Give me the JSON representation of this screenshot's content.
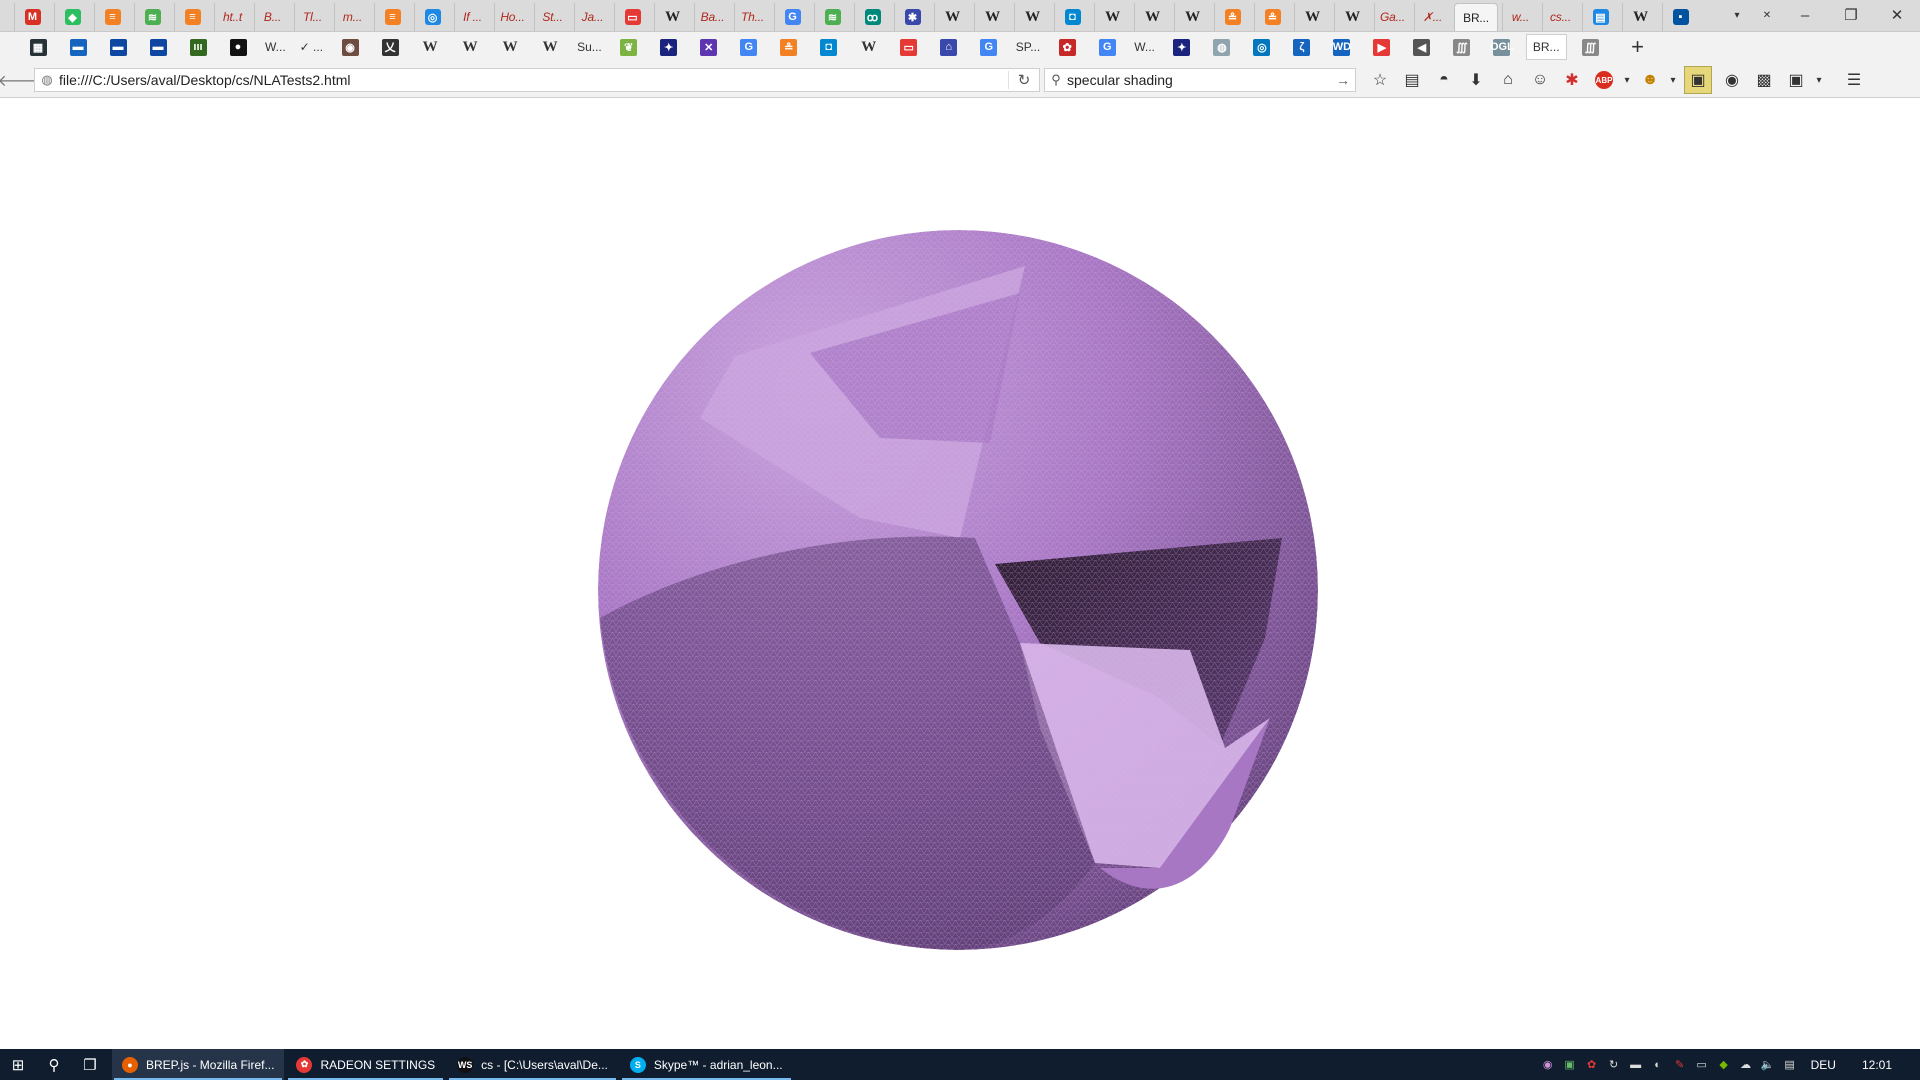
{
  "browser": {
    "tabs": [
      {
        "favicon": "gmail-icon",
        "color": "#d93025",
        "glyph": "M",
        "text": ""
      },
      {
        "favicon": "evernote-icon",
        "color": "#2dbe60",
        "glyph": "◆",
        "text": ""
      },
      {
        "favicon": "stack-icon",
        "color": "#f48024",
        "glyph": "≡",
        "text": ""
      },
      {
        "favicon": "wolfram-icon",
        "color": "#4caf50",
        "glyph": "≋",
        "text": ""
      },
      {
        "favicon": "stack-icon",
        "color": "#f48024",
        "glyph": "≡",
        "text": ""
      },
      {
        "favicon": "",
        "color": "",
        "glyph": "",
        "text": "ht..t"
      },
      {
        "favicon": "",
        "color": "",
        "glyph": "",
        "text": "B..."
      },
      {
        "favicon": "",
        "color": "",
        "glyph": "",
        "text": "Tl..."
      },
      {
        "favicon": "",
        "color": "",
        "glyph": "",
        "text": "m..."
      },
      {
        "favicon": "stack-icon",
        "color": "#f48024",
        "glyph": "≡",
        "text": ""
      },
      {
        "favicon": "discord-icon",
        "color": "#1e88e5",
        "glyph": "◎",
        "text": ""
      },
      {
        "favicon": "",
        "color": "",
        "glyph": "",
        "text": "If ..."
      },
      {
        "favicon": "",
        "color": "",
        "glyph": "",
        "text": "Ho..."
      },
      {
        "favicon": "",
        "color": "",
        "glyph": "",
        "text": "St..."
      },
      {
        "favicon": "",
        "color": "",
        "glyph": "",
        "text": "Ja..."
      },
      {
        "favicon": "oracle-icon",
        "color": "#e53935",
        "glyph": "▭",
        "text": ""
      },
      {
        "favicon": "",
        "color": "",
        "glyph": "",
        "text": "W",
        "wiki": true
      },
      {
        "favicon": "",
        "color": "",
        "glyph": "",
        "text": "Ba..."
      },
      {
        "favicon": "",
        "color": "",
        "glyph": "",
        "text": "Th..."
      },
      {
        "favicon": "google-icon",
        "color": "#4285f4",
        "glyph": "G",
        "text": ""
      },
      {
        "favicon": "wolfram-icon",
        "color": "#4caf50",
        "glyph": "≋",
        "text": ""
      },
      {
        "favicon": "script-icon",
        "color": "#00897b",
        "glyph": "ꝏ",
        "text": ""
      },
      {
        "favicon": "shield-icon",
        "color": "#3949ab",
        "glyph": "✱",
        "text": ""
      },
      {
        "favicon": "",
        "color": "",
        "glyph": "",
        "text": "W",
        "wiki": true
      },
      {
        "favicon": "",
        "color": "",
        "glyph": "",
        "text": "W",
        "wiki": true
      },
      {
        "favicon": "",
        "color": "",
        "glyph": "",
        "text": "W",
        "wiki": true
      },
      {
        "favicon": "chat-icon",
        "color": "#0288d1",
        "glyph": "◘",
        "text": ""
      },
      {
        "favicon": "",
        "color": "",
        "glyph": "",
        "text": "W",
        "wiki": true
      },
      {
        "favicon": "",
        "color": "",
        "glyph": "",
        "text": "W",
        "wiki": true
      },
      {
        "favicon": "",
        "color": "",
        "glyph": "",
        "text": "W",
        "wiki": true
      },
      {
        "favicon": "stack-icon",
        "color": "#f48024",
        "glyph": "≗",
        "text": ""
      },
      {
        "favicon": "stack-icon",
        "color": "#f48024",
        "glyph": "≗",
        "text": ""
      },
      {
        "favicon": "",
        "color": "",
        "glyph": "",
        "text": "W",
        "wiki": true
      },
      {
        "favicon": "",
        "color": "",
        "glyph": "",
        "text": "W",
        "wiki": true
      },
      {
        "favicon": "",
        "color": "",
        "glyph": "",
        "text": "Ga..."
      },
      {
        "favicon": "",
        "color": "",
        "glyph": "",
        "text": "✗..."
      },
      {
        "favicon": "",
        "color": "",
        "glyph": "",
        "text": "BR...",
        "active_style": true
      },
      {
        "favicon": "",
        "color": "",
        "glyph": "",
        "text": "w..."
      },
      {
        "favicon": "",
        "color": "",
        "glyph": "",
        "text": "cs..."
      },
      {
        "favicon": "layers-icon",
        "color": "#1e88e5",
        "glyph": "▤",
        "text": ""
      },
      {
        "favicon": "",
        "color": "",
        "glyph": "",
        "text": "W",
        "wiki": true
      },
      {
        "favicon": "rwth-icon",
        "color": "#00549f",
        "glyph": "▪",
        "text": ""
      }
    ],
    "window_controls": {
      "dropdown": "▾",
      "minimize": "–",
      "maximize": "❐",
      "close": "✕"
    },
    "bookmarks": [
      {
        "icon": "film-icon",
        "color": "#263238",
        "glyph": "▦",
        "text": ""
      },
      {
        "icon": "site-icon",
        "color": "#1565c0",
        "glyph": "▬",
        "text": ""
      },
      {
        "icon": "site-icon",
        "color": "#0d47a1",
        "glyph": "▬",
        "text": ""
      },
      {
        "icon": "site-icon",
        "color": "#0d47a1",
        "glyph": "▬",
        "text": ""
      },
      {
        "icon": "film-icon",
        "color": "#33691e",
        "glyph": "ııı",
        "text": ""
      },
      {
        "icon": "github-icon",
        "color": "#111111",
        "glyph": "●",
        "text": ""
      },
      {
        "icon": "",
        "color": "",
        "glyph": "",
        "text": "W..."
      },
      {
        "icon": "check-icon",
        "color": "",
        "glyph": "",
        "text": "✓ ..."
      },
      {
        "icon": "owl-icon",
        "color": "#6d4c41",
        "glyph": "◉",
        "text": ""
      },
      {
        "icon": "dictionary-icon",
        "color": "#333333",
        "glyph": "乂",
        "text": ""
      },
      {
        "icon": "",
        "color": "",
        "glyph": "",
        "text": "W",
        "wiki": true
      },
      {
        "icon": "",
        "color": "",
        "glyph": "",
        "text": "W",
        "wiki": true
      },
      {
        "icon": "",
        "color": "",
        "glyph": "",
        "text": "W",
        "wiki": true
      },
      {
        "icon": "",
        "color": "",
        "glyph": "",
        "text": "W",
        "wiki": true
      },
      {
        "icon": "",
        "color": "",
        "glyph": "",
        "text": "Su..."
      },
      {
        "icon": "leaf-icon",
        "color": "#7cb342",
        "glyph": "❦",
        "text": ""
      },
      {
        "icon": "eu-icon",
        "color": "#1a237e",
        "glyph": "✦",
        "text": ""
      },
      {
        "icon": "puzzle-icon",
        "color": "#5e35b1",
        "glyph": "✕",
        "text": ""
      },
      {
        "icon": "google-icon",
        "color": "#4285f4",
        "glyph": "G",
        "text": ""
      },
      {
        "icon": "stack-icon",
        "color": "#f48024",
        "glyph": "≗",
        "text": ""
      },
      {
        "icon": "chat-icon",
        "color": "#0288d1",
        "glyph": "◘",
        "text": ""
      },
      {
        "icon": "",
        "color": "",
        "glyph": "",
        "text": "W",
        "wiki": true
      },
      {
        "icon": "oracle-icon",
        "color": "#e53935",
        "glyph": "▭",
        "text": ""
      },
      {
        "icon": "museum-icon",
        "color": "#3949ab",
        "glyph": "⌂",
        "text": ""
      },
      {
        "icon": "google-icon",
        "color": "#4285f4",
        "glyph": "G",
        "text": ""
      },
      {
        "icon": "",
        "color": "",
        "glyph": "",
        "text": "SP..."
      },
      {
        "icon": "gear-red-icon",
        "color": "#c62828",
        "glyph": "✿",
        "text": ""
      },
      {
        "icon": "google-icon",
        "color": "#4285f4",
        "glyph": "G",
        "text": ""
      },
      {
        "icon": "",
        "color": "",
        "glyph": "",
        "text": "W..."
      },
      {
        "icon": "eu-icon",
        "color": "#1a237e",
        "glyph": "✦",
        "text": ""
      },
      {
        "icon": "reddit-icon",
        "color": "#90a4ae",
        "glyph": "◍",
        "text": ""
      },
      {
        "icon": "search-site-icon",
        "color": "#0277bd",
        "glyph": "◎",
        "text": ""
      },
      {
        "icon": "code-icon",
        "color": "#1565c0",
        "glyph": "ζ",
        "text": ""
      },
      {
        "icon": "wd-icon",
        "color": "#1565c0",
        "glyph": "WD",
        "text": ""
      },
      {
        "icon": "youtube-icon",
        "color": "#e53935",
        "glyph": "▶",
        "text": ""
      },
      {
        "icon": "volume-icon",
        "color": "#555555",
        "glyph": "◀",
        "text": ""
      },
      {
        "icon": "stripes-icon",
        "color": "#888888",
        "glyph": "∭",
        "text": ""
      },
      {
        "icon": "ogl-icon",
        "color": "#78909c",
        "glyph": "OGL",
        "text": ""
      },
      {
        "icon": "",
        "color": "",
        "glyph": "",
        "text": "BR...",
        "active": true
      },
      {
        "icon": "stripes-icon",
        "color": "#888888",
        "glyph": "∭",
        "text": ""
      }
    ],
    "url": "file:///C:/Users/aval/Desktop/cs/NLATests2.html",
    "search": {
      "value": "specular shading"
    }
  },
  "render": {
    "colors": {
      "base": "#a877c4",
      "shadow": "#5a3a70",
      "dark": "#2f1e33",
      "light": "#c9a3dd",
      "mesh": "#d8b6ea"
    }
  },
  "taskbar": {
    "items": [
      {
        "label": "BREP.js - Mozilla Firef...",
        "icon": "firefox-icon",
        "color": "#e66000",
        "glyph": "●",
        "active": true
      },
      {
        "label": "RADEON SETTINGS",
        "icon": "radeon-icon",
        "color": "#e53935",
        "glyph": "✿",
        "active": false
      },
      {
        "label": "cs - [C:\\Users\\aval\\De...",
        "icon": "webstorm-icon",
        "color": "#111111",
        "glyph": "WS",
        "active": false
      },
      {
        "label": "Skype™ - adrian_leon...",
        "icon": "skype-icon",
        "color": "#00aff0",
        "glyph": "S",
        "active": false
      }
    ],
    "language": "DEU",
    "clock": "12:01"
  }
}
